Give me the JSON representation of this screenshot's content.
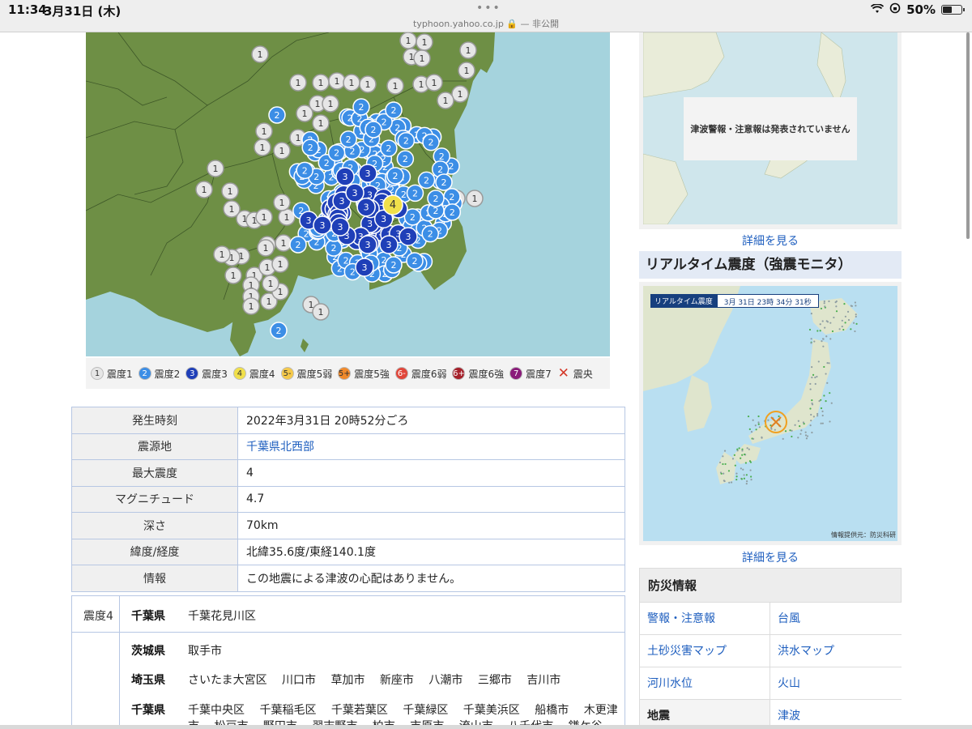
{
  "status_bar": {
    "time": "11:34",
    "date": "3月31日 (木)",
    "url": "typhoon.yahoo.co.jp 🔒 — 非公開",
    "battery": "50%",
    "battery_level": 0.5
  },
  "map": {
    "land_color": "#6e8f45",
    "sea_color": "#a5d3dd",
    "intensity_colors": {
      "1": "#e6e6e6",
      "2": "#3c8ee6",
      "3": "#1f3fb8",
      "4": "#f1e04a"
    },
    "epicenter_label": "4"
  },
  "legend": [
    {
      "mark": "1",
      "label": "震度1",
      "color": "#e6e6e6",
      "text_color": "#333333"
    },
    {
      "mark": "2",
      "label": "震度2",
      "color": "#3c8ee6",
      "text_color": "#ffffff"
    },
    {
      "mark": "3",
      "label": "震度3",
      "color": "#1f3fb8",
      "text_color": "#ffffff"
    },
    {
      "mark": "4",
      "label": "震度4",
      "color": "#f1e04a",
      "text_color": "#333333"
    },
    {
      "mark": "5-",
      "label": "震度5弱",
      "color": "#f5c94a",
      "text_color": "#333333"
    },
    {
      "mark": "5+",
      "label": "震度5強",
      "color": "#f08a2c",
      "text_color": "#333333"
    },
    {
      "mark": "6-",
      "label": "震度6弱",
      "color": "#e0463a",
      "text_color": "#ffffff"
    },
    {
      "mark": "6+",
      "label": "震度6強",
      "color": "#a5202a",
      "text_color": "#ffffff"
    },
    {
      "mark": "7",
      "label": "震度7",
      "color": "#8a1b7a",
      "text_color": "#ffffff"
    },
    {
      "mark": "✕",
      "label": "震央",
      "color": "none",
      "text_color": "#d43a2a"
    }
  ],
  "info": [
    {
      "key": "発生時刻",
      "value": "2022年3月31日 20時52分ごろ",
      "link": false
    },
    {
      "key": "震源地",
      "value": "千葉県北西部",
      "link": true
    },
    {
      "key": "最大震度",
      "value": "4",
      "link": false
    },
    {
      "key": "マグニチュード",
      "value": "4.7",
      "link": false
    },
    {
      "key": "深さ",
      "value": "70km",
      "link": false
    },
    {
      "key": "緯度/経度",
      "value": "北緯35.6度/東経140.1度",
      "link": false
    },
    {
      "key": "情報",
      "value": "この地震による津波の心配はありません。",
      "link": false
    }
  ],
  "intensity_list": {
    "level4_label": "震度4",
    "level4_pref": "千葉県",
    "level4_cities": "千葉花見川区",
    "rows": [
      {
        "pref": "茨城県",
        "cities": "取手市"
      },
      {
        "pref": "埼玉県",
        "cities": "さいたま大宮区　 川口市　 草加市　 新座市　 八潮市　 三郷市　 吉川市"
      },
      {
        "pref": "千葉県",
        "cities": "千葉中央区　 千葉稲毛区　 千葉若葉区　 千葉緑区　 千葉美浜区　 船橋市　 木更津"
      },
      {
        "pref": "",
        "cities": "市　 松戸市　 野田市　 習志野市　 柏市　 市原市　 流山市　 八千代市　 鎌ケ谷"
      }
    ]
  },
  "tsunami": {
    "message": "津波警報・注意報は発表されていません",
    "more": "詳細を見る"
  },
  "realtime": {
    "title": "リアルタイム震度（強震モニタ）",
    "badge": "リアルタイム震度",
    "timestamp": "3月 31日 23時 34分 31秒",
    "credit": "情報提供元：防災科研",
    "more": "詳細を見る"
  },
  "bosai": {
    "title": "防災情報",
    "items": [
      "警報・注意報",
      "台風",
      "土砂災害マップ",
      "洪水マップ",
      "河川水位",
      "火山",
      "地震",
      "津波"
    ]
  }
}
